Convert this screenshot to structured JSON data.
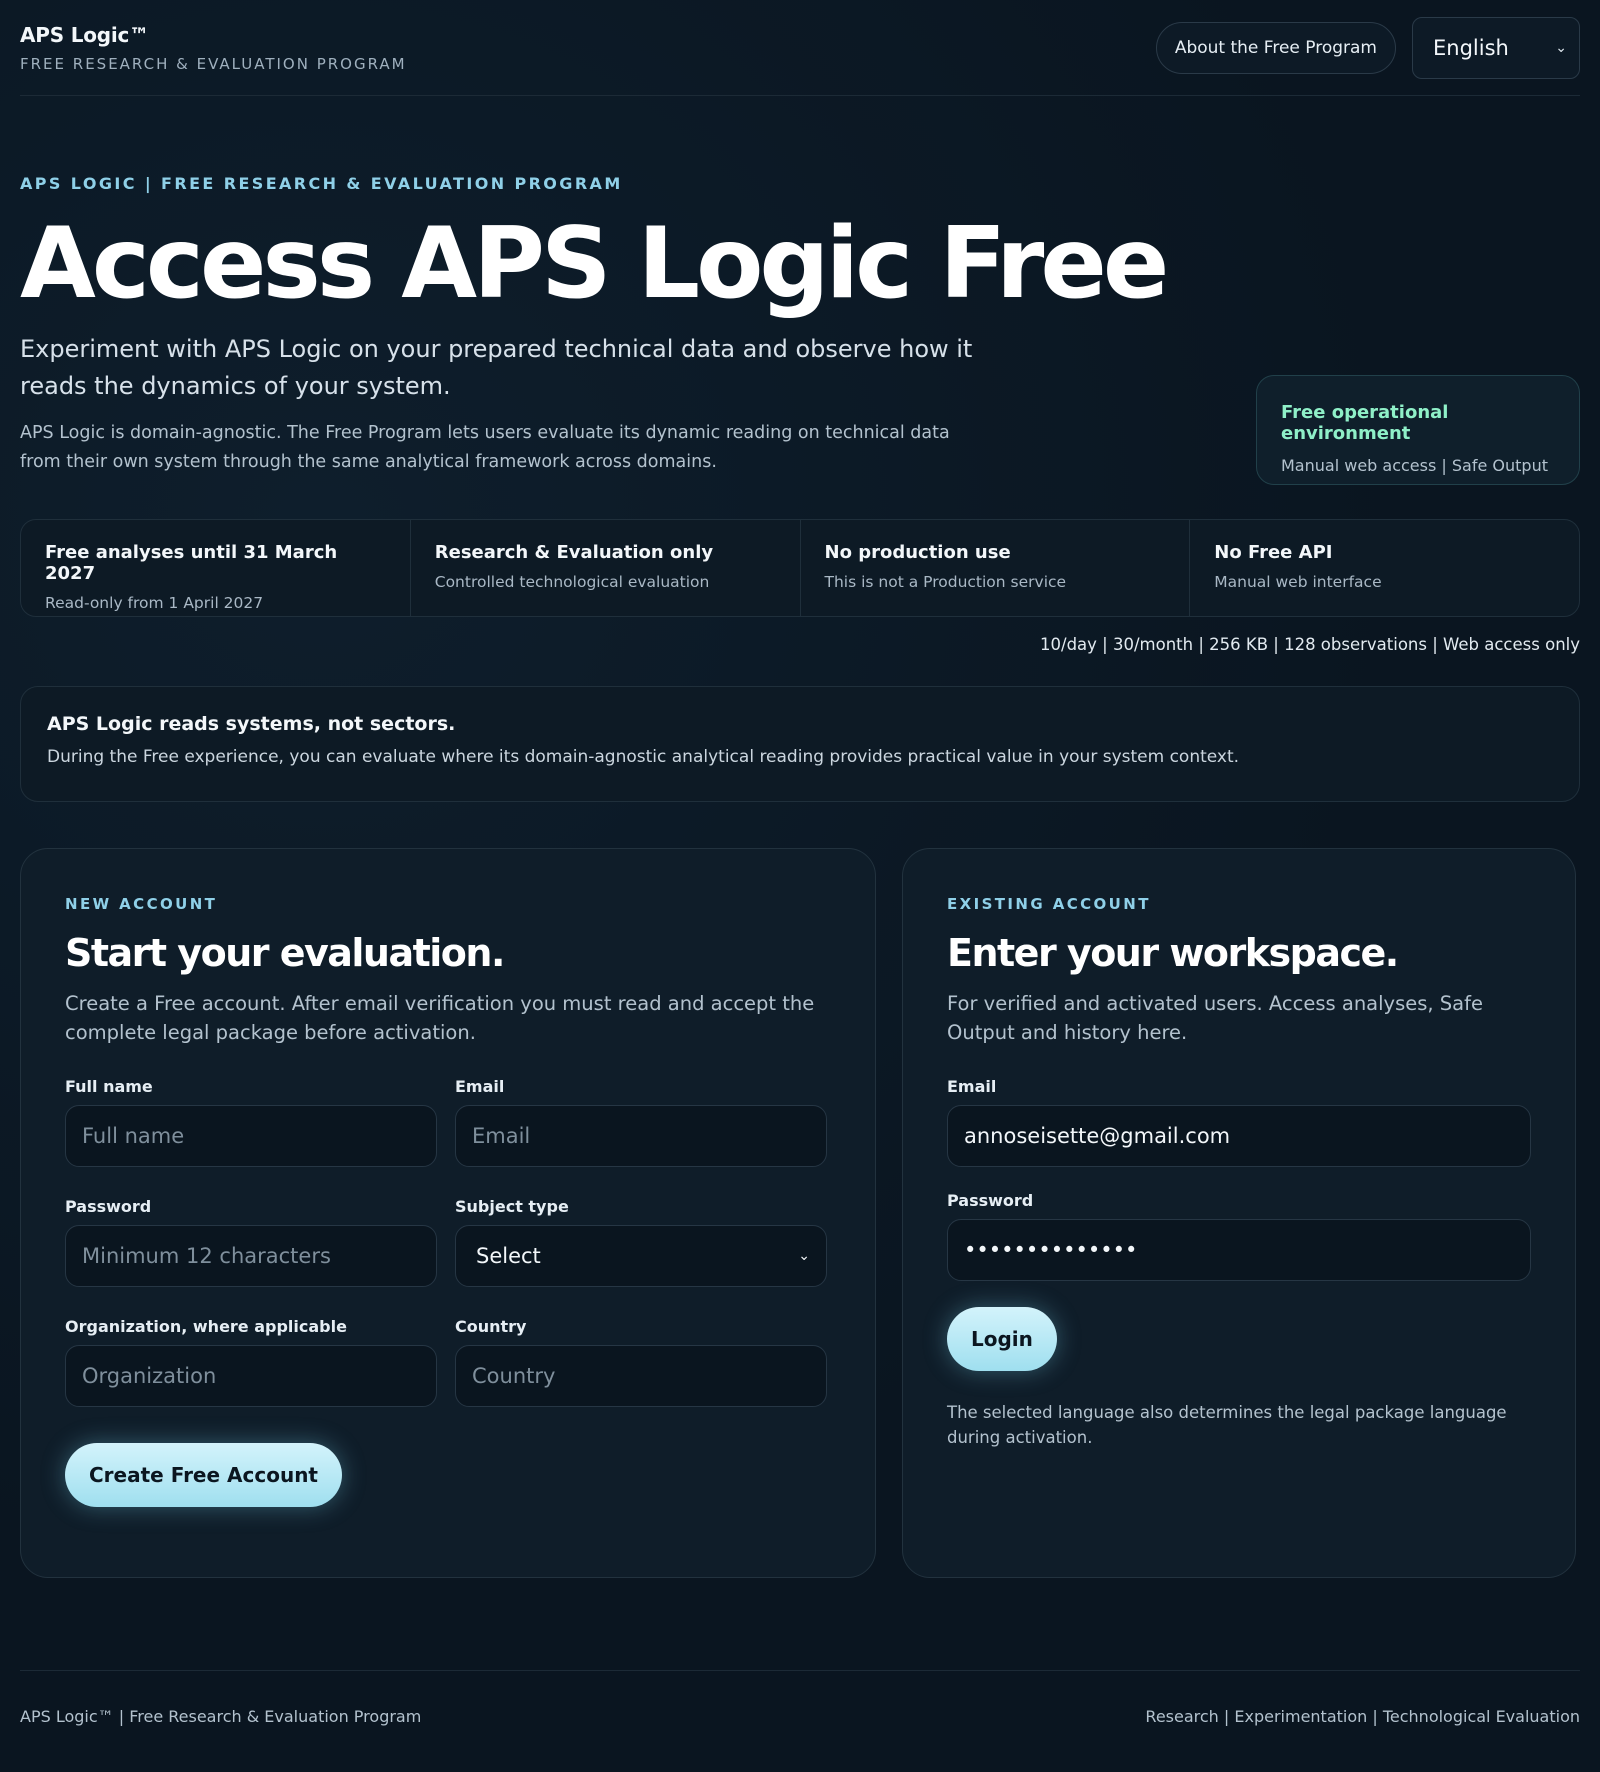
{
  "header": {
    "brand_name": "APS Logic™",
    "brand_sub": "FREE RESEARCH & EVALUATION PROGRAM",
    "about_label": "About the Free Program",
    "language": "English"
  },
  "hero": {
    "eyebrow": "APS LOGIC | FREE RESEARCH & EVALUATION PROGRAM",
    "title": "Access APS Logic Free",
    "lead": "Experiment with APS Logic on your prepared technical data and observe how it reads the dynamics of your system.",
    "desc": "APS Logic is domain-agnostic. The Free Program lets users evaluate its dynamic reading on technical data from their own system through the same analytical framework across domains.",
    "env_title": "Free operational environment",
    "env_sub": "Manual web access | Safe Output"
  },
  "features": [
    {
      "title": "Free analyses until 31 March 2027",
      "sub": "Read-only from 1 April 2027"
    },
    {
      "title": "Research & Evaluation only",
      "sub": "Controlled technological evaluation"
    },
    {
      "title": "No production use",
      "sub": "This is not a Production service"
    },
    {
      "title": "No Free API",
      "sub": "Manual web interface"
    }
  ],
  "limits": "10/day | 30/month | 256 KB | 128 observations | Web access only",
  "note": {
    "title": "APS Logic reads systems, not sectors.",
    "body": "During the Free experience, you can evaluate where its domain-agnostic analytical reading provides practical value in your system context."
  },
  "new_account": {
    "eyebrow": "NEW ACCOUNT",
    "title": "Start your evaluation.",
    "desc": "Create a Free account. After email verification you must read and accept the complete legal package before activation.",
    "full_name_label": "Full name",
    "full_name_placeholder": "Full name",
    "email_label": "Email",
    "email_placeholder": "Email",
    "password_label": "Password",
    "password_placeholder": "Minimum 12 characters",
    "subject_label": "Subject type",
    "subject_value": "Select",
    "org_label": "Organization, where applicable",
    "org_placeholder": "Organization",
    "country_label": "Country",
    "country_placeholder": "Country",
    "submit_label": "Create Free Account"
  },
  "existing_account": {
    "eyebrow": "EXISTING ACCOUNT",
    "title": "Enter your workspace.",
    "desc": "For verified and activated users. Access analyses, Safe Output and history here.",
    "email_label": "Email",
    "email_value": "annoseisette@gmail.com",
    "password_label": "Password",
    "password_value": "••••••••••••••",
    "login_label": "Login",
    "lang_note": "The selected language also determines the legal package language during activation."
  },
  "footer": {
    "left": "APS Logic™ | Free Research & Evaluation Program",
    "right": "Research | Experimentation | Technological Evaluation"
  }
}
